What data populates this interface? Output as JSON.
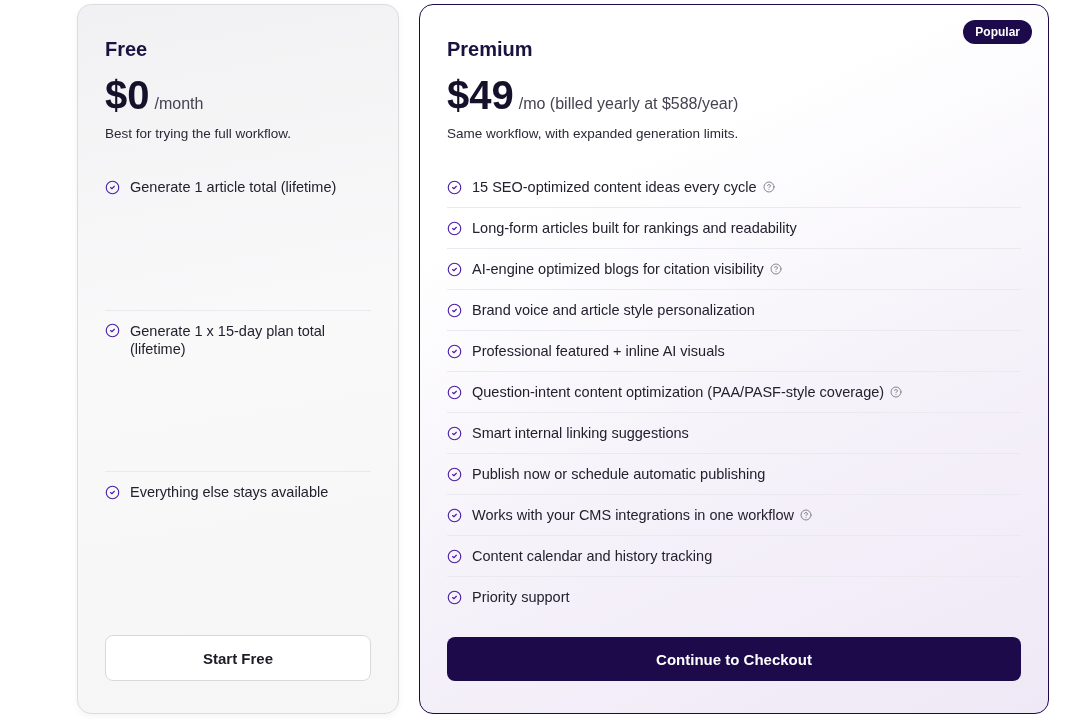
{
  "plans": [
    {
      "kind": "basic",
      "name": "Free",
      "price": "$0",
      "period": "/month",
      "description": "Best for trying the full workflow.",
      "features": [
        {
          "text": "Generate 1 article total (lifetime)",
          "info": false
        },
        {
          "text": "Generate 1 x 15-day plan total (lifetime)",
          "info": false
        },
        {
          "text": "Everything else stays available",
          "info": false
        }
      ],
      "button": "Start Free"
    },
    {
      "kind": "featured",
      "name": "Premium",
      "badge": "Popular",
      "price": "$49",
      "period": "/mo (billed yearly at $588/year)",
      "description": "Same workflow, with expanded generation limits.",
      "features": [
        {
          "text": "15 SEO-optimized content ideas every cycle",
          "info": true
        },
        {
          "text": "Long-form articles built for rankings and readability",
          "info": false
        },
        {
          "text": "AI-engine optimized blogs for citation visibility",
          "info": true
        },
        {
          "text": "Brand voice and article style personalization",
          "info": false
        },
        {
          "text": "Professional featured + inline AI visuals",
          "info": false
        },
        {
          "text": "Question-intent content optimization (PAA/PASF-style coverage)",
          "info": true
        },
        {
          "text": "Smart internal linking suggestions",
          "info": false
        },
        {
          "text": "Publish now or schedule automatic publishing",
          "info": false
        },
        {
          "text": "Works with your CMS integrations in one workflow",
          "info": true
        },
        {
          "text": "Content calendar and history tracking",
          "info": false
        },
        {
          "text": "Priority support",
          "info": false
        }
      ],
      "button": "Continue to Checkout"
    }
  ]
}
